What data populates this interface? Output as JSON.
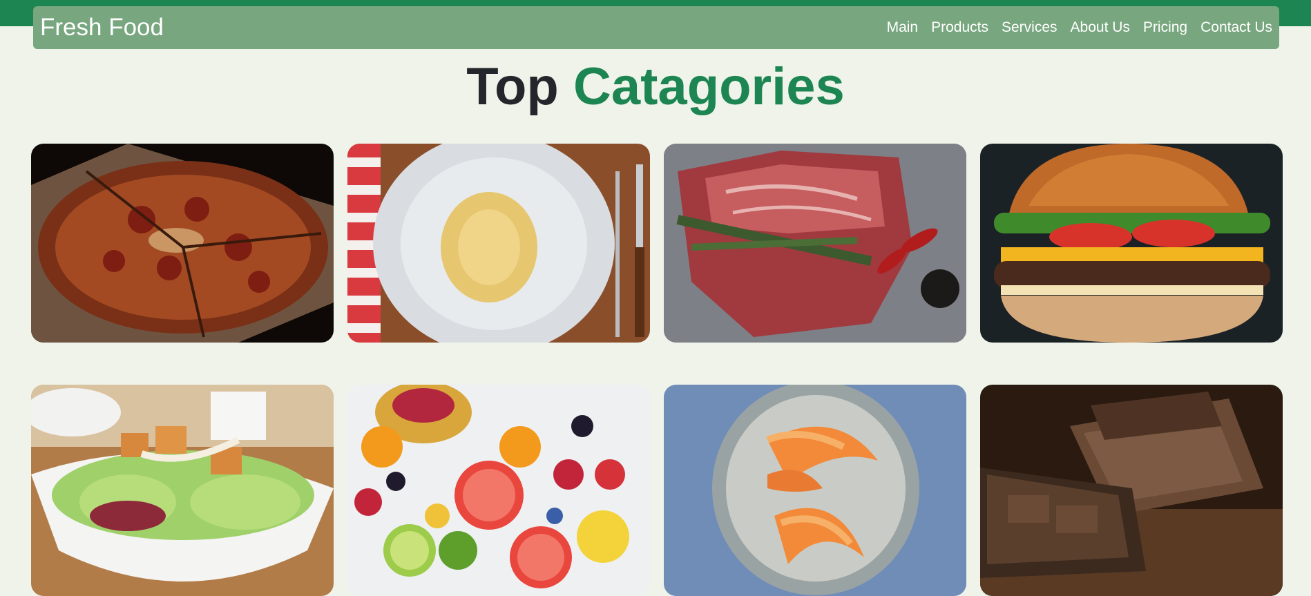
{
  "header": {
    "brand": "Fresh Food",
    "nav": [
      {
        "label": "Main"
      },
      {
        "label": "Products"
      },
      {
        "label": "Services"
      },
      {
        "label": "About Us"
      },
      {
        "label": "Pricing"
      },
      {
        "label": "Contact Us"
      }
    ]
  },
  "section": {
    "title_part1": "Top",
    "title_part2": "Catagories"
  },
  "colors": {
    "top_bar": "#1c8552",
    "navbar": "#78a77f",
    "background": "#eff3ea",
    "accent": "#1c8552"
  },
  "categories": [
    {
      "image": "pizza-image"
    },
    {
      "image": "pasta-image"
    },
    {
      "image": "steak-image"
    },
    {
      "image": "burger-image"
    },
    {
      "image": "salad-image"
    },
    {
      "image": "fruit-platter-image"
    },
    {
      "image": "shrimp-image"
    },
    {
      "image": "chocolate-image"
    }
  ]
}
